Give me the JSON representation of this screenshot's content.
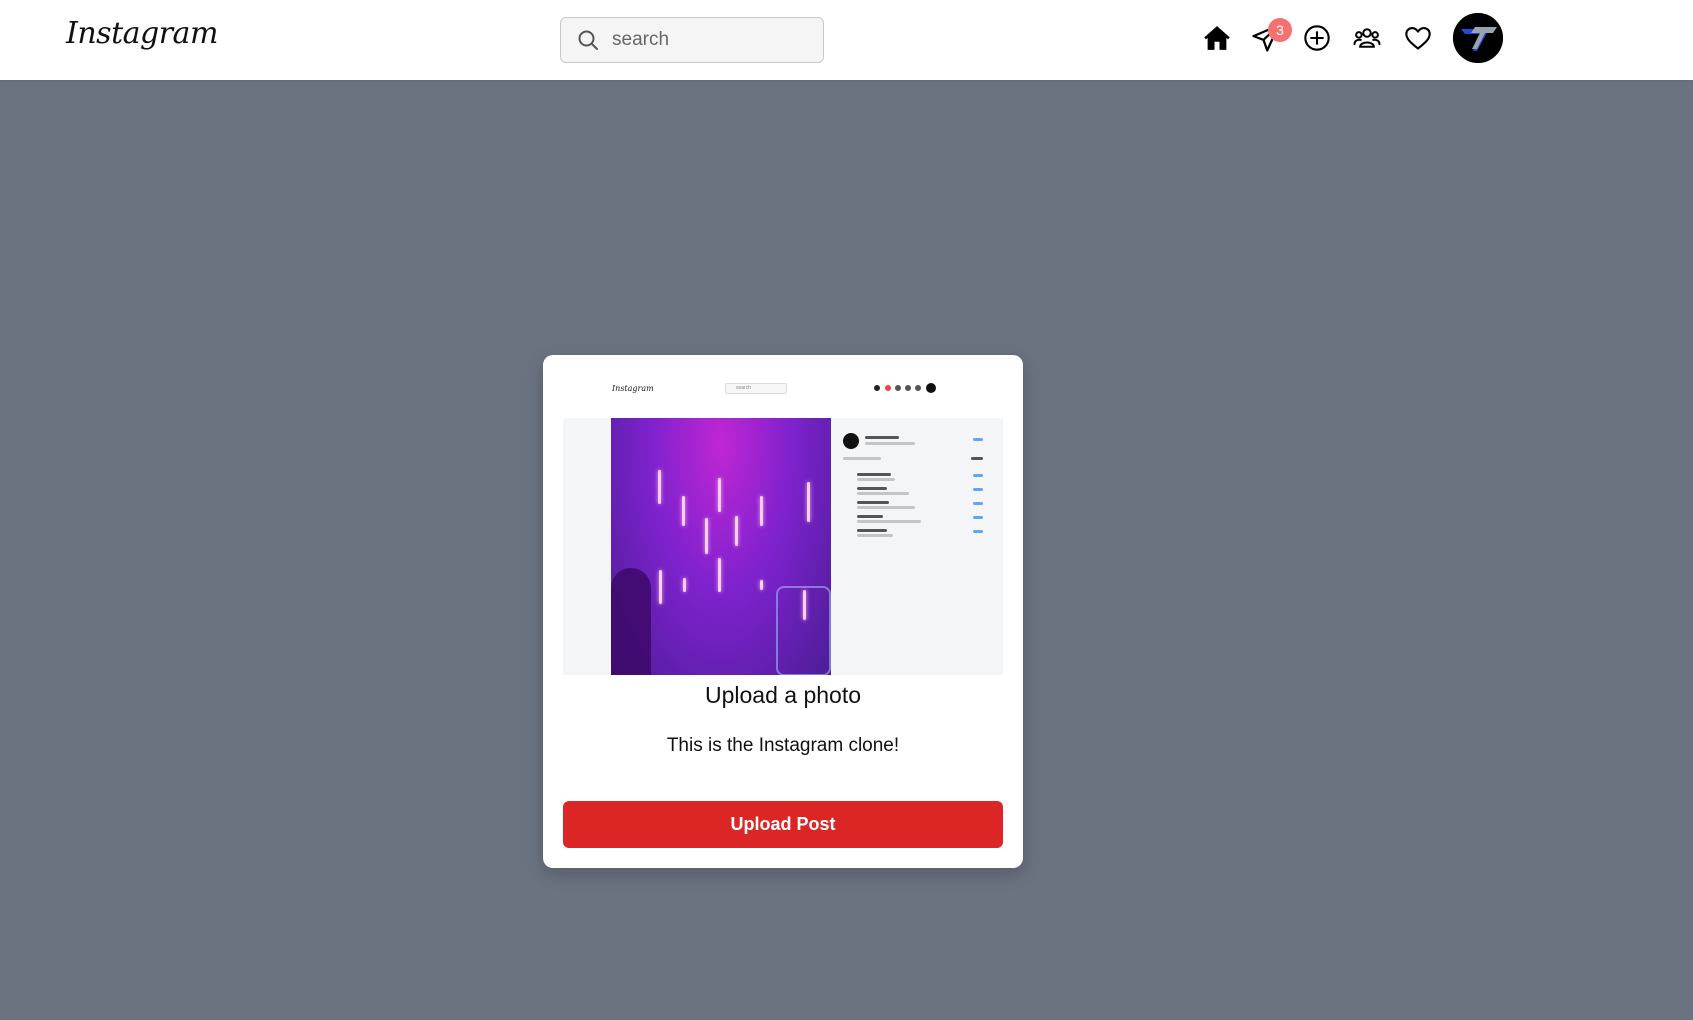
{
  "header": {
    "logo_text": "Instagram",
    "search": {
      "placeholder": "search",
      "value": ""
    },
    "nav": {
      "home_icon": "home-icon",
      "messages_icon": "paper-plane-icon",
      "messages_badge": "3",
      "create_icon": "plus-circle-icon",
      "explore_icon": "users-icon",
      "activity_icon": "heart-icon",
      "avatar_icon": "avatar"
    }
  },
  "modal": {
    "preview": {
      "logo_text": "Instagram",
      "search_placeholder": "search"
    },
    "title": "Upload a photo",
    "description": "This is the Instagram clone!",
    "upload_button_label": "Upload Post"
  },
  "colors": {
    "overlay": "#6b7280",
    "upload_button": "#dc2626",
    "badge": "#f87171"
  }
}
